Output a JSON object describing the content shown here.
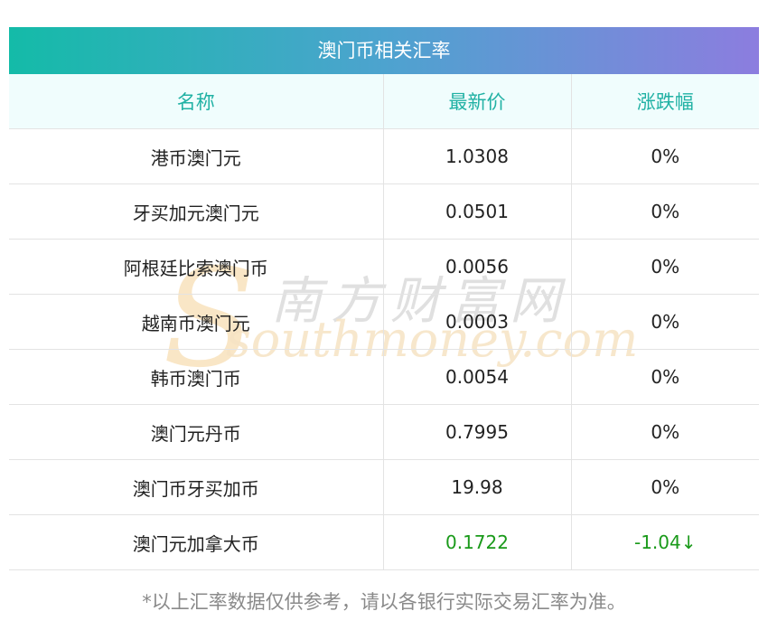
{
  "title": "澳门币相关汇率",
  "headers": [
    "名称",
    "最新价",
    "涨跌幅"
  ],
  "rows": [
    {
      "name": "港币澳门元",
      "price": "1.0308",
      "change": "0%"
    },
    {
      "name": "牙买加元澳门元",
      "price": "0.0501",
      "change": "0%"
    },
    {
      "name": "阿根廷比索澳门币",
      "price": "0.0056",
      "change": "0%"
    },
    {
      "name": "越南币澳门元",
      "price": "0.0003",
      "change": "0%"
    },
    {
      "name": "韩币澳门币",
      "price": "0.0054",
      "change": "0%"
    },
    {
      "name": "澳门元丹币",
      "price": "0.7995",
      "change": "0%"
    },
    {
      "name": "澳门币牙买加币",
      "price": "19.98",
      "change": "0%"
    },
    {
      "name": "澳门元加拿大币",
      "price": "0.1722",
      "change": "-1.04↓"
    }
  ],
  "watermark": {
    "cn": "南方财富网",
    "en": "southmoney.com"
  },
  "note": "*以上汇率数据仅供参考，请以各银行实际交易汇率为准。",
  "colors": {
    "header_text": "#20b1a4",
    "title_gradient_start": "#14bba8",
    "title_gradient_end": "#8c7ddf",
    "down_text": "#1a9a1a"
  }
}
